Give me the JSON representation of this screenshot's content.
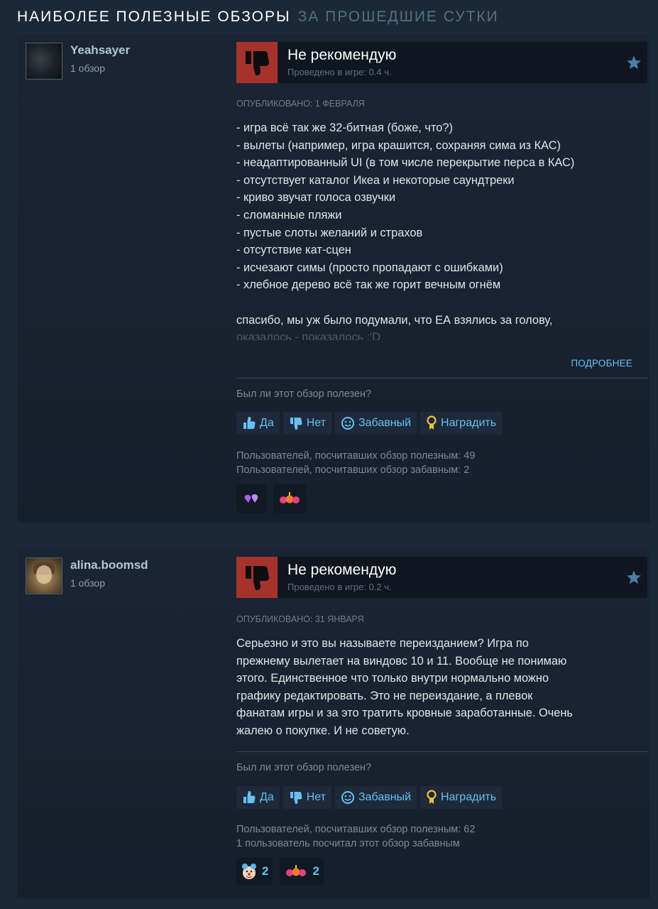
{
  "header": {
    "title": "НАИБОЛЕЕ ПОЛЕЗНЫЕ ОБЗОРЫ",
    "period": "ЗА ПРОШЕДШИЕ СУТКИ"
  },
  "colors": {
    "background": "#1b2838",
    "not_recommended": "#a5322c",
    "link": "#66c0f4"
  },
  "reviews": [
    {
      "username": "Yeahsayer",
      "review_count": "1 обзор",
      "verdict": "Не рекомендую",
      "playtime": "Проведено в игре: 0.4 ч.",
      "posted": "ОПУБЛИКОВАНО: 1 ФЕВРАЛЯ",
      "lines": [
        "- игра всё так же 32-битная (боже, что?)",
        "- вылеты (например, игра крашится, сохраняя сима из КАС)",
        "- неадаптированный UI (в том числе перекрытие перса в КАС)",
        "- отсутствует каталог Икеа и некоторые саундтреки",
        "- криво звучат голоса озвучки",
        "- сломанные пляжи",
        "- пустые слоты желаний и страхов",
        "- отсутствие кат-сцен",
        "- исчезают симы (просто пропадают с ошибками)",
        "- хлебное дерево всё так же горит вечным огнём"
      ],
      "closing": "спасибо, мы уж было подумали, что ЕА взялись за голову,",
      "closing_faded": "оказалось - показалось :'D",
      "more_label": "ПОДРОБНЕЕ",
      "helpful_question": "Был ли этот обзор полезен?",
      "buttons": {
        "yes": "Да",
        "no": "Нет",
        "funny": "Забавный",
        "award": "Наградить"
      },
      "stat_helpful": "Пользователей, посчитавших обзор полезным: 49",
      "stat_funny": "Пользователей, посчитавших обзор забавным: 2",
      "awards": [
        {
          "icon": "purple-hearts-award-icon",
          "count": ""
        },
        {
          "icon": "fireworks-award-icon",
          "count": ""
        }
      ]
    },
    {
      "username": "alina.boomsd",
      "review_count": "1 обзор",
      "verdict": "Не рекомендую",
      "playtime": "Проведено в игре: 0.2 ч.",
      "posted": "ОПУБЛИКОВАНО: 31 ЯНВАРЯ",
      "lines": [
        "Серьезно и это вы называете переизданием? Игра по",
        "прежнему вылетает на виндовс 10 и 11. Вообще не понимаю",
        "этого. Единственное что только внутри нормально можно",
        "графику редактировать. Это не переиздание, а плевок",
        "фанатам игры и за это тратить кровные заработанные. Очень",
        "жалею о покупке. И не советую."
      ],
      "helpful_question": "Был ли этот обзор полезен?",
      "buttons": {
        "yes": "Да",
        "no": "Нет",
        "funny": "Забавный",
        "award": "Наградить"
      },
      "stat_helpful": "Пользователей, посчитавших обзор полезным: 62",
      "stat_funny": "1 пользователь посчитал этот обзор забавным",
      "awards": [
        {
          "icon": "clown-face-award-icon",
          "count": "2"
        },
        {
          "icon": "fireworks-award-icon",
          "count": "2"
        }
      ]
    }
  ]
}
